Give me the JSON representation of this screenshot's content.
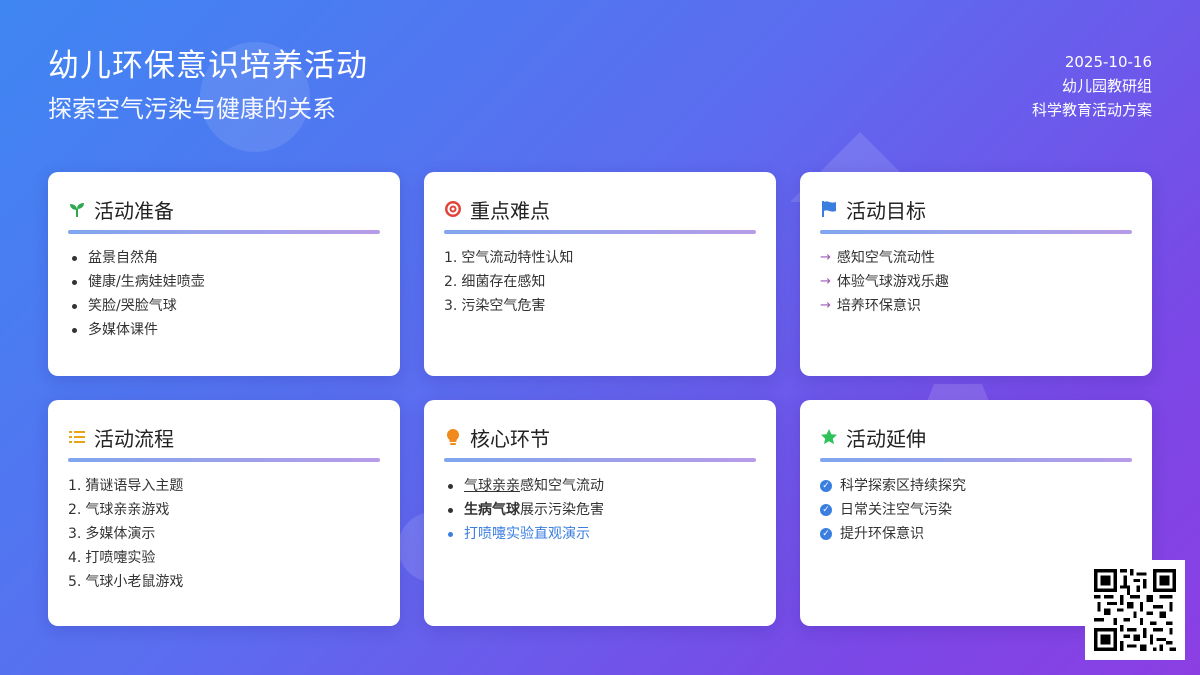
{
  "header": {
    "title": "幼儿环保意识培养活动",
    "subtitle": "探索空气污染与健康的关系",
    "date": "2025-10-16",
    "org": "幼儿园教研组",
    "doc_type": "科学教育活动方案"
  },
  "cards": {
    "prep": {
      "title": "活动准备",
      "icon": "seedling-icon",
      "items": [
        "盆景自然角",
        "健康/生病娃娃喷壶",
        "笑脸/哭脸气球",
        "多媒体课件"
      ]
    },
    "key": {
      "title": "重点难点",
      "icon": "target-icon",
      "items": [
        "空气流动特性认知",
        "细菌存在感知",
        "污染空气危害"
      ]
    },
    "goal": {
      "title": "活动目标",
      "icon": "flag-icon",
      "items": [
        "感知空气流动性",
        "体验气球游戏乐趣",
        "培养环保意识"
      ]
    },
    "flow": {
      "title": "活动流程",
      "icon": "list-icon",
      "items": [
        "猜谜语导入主题",
        "气球亲亲游戏",
        "多媒体演示",
        "打喷嚏实验",
        "气球小老鼠游戏"
      ]
    },
    "core": {
      "title": "核心环节",
      "icon": "lightbulb-icon",
      "item1_em": "气球亲亲",
      "item1_rest": "感知空气流动",
      "item2_em": "生病气球",
      "item2_rest": "展示污染危害",
      "item3": "打喷嚏实验直观演示"
    },
    "ext": {
      "title": "活动延伸",
      "icon": "star-icon",
      "items": [
        "科学探索区持续探究",
        "日常关注空气污染",
        "提升环保意识"
      ]
    }
  },
  "colors": {
    "accent_blue": "#3a7ee0",
    "accent_purple": "#9b59b6",
    "bg_start": "#3f86f2",
    "bg_end": "#8b3fe3"
  }
}
